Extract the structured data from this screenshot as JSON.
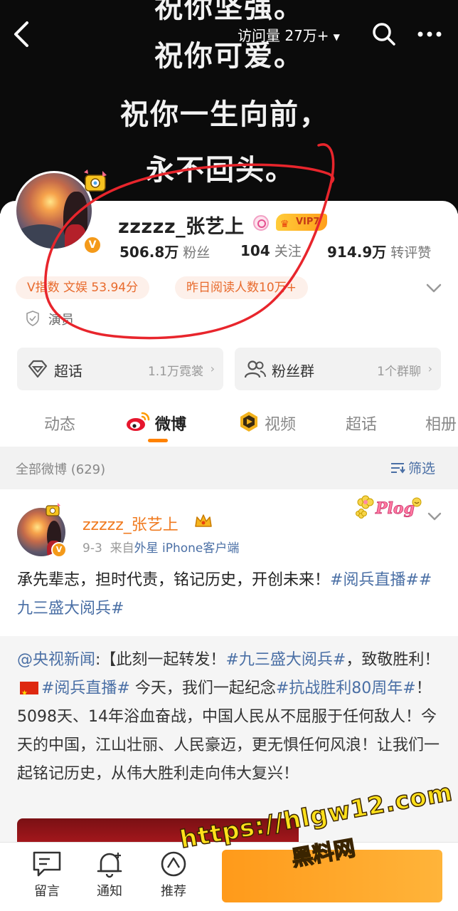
{
  "banner": {
    "lines": [
      "祝你坚强。",
      "祝你可爱。",
      "祝你一生向前，",
      "永不回头。"
    ]
  },
  "topbar": {
    "visits": "访问量 27万+"
  },
  "profile": {
    "name": "zzzzz_张艺上",
    "vip_level": "VIP7",
    "stats": [
      {
        "value": "506.8万",
        "label": "粉丝"
      },
      {
        "value": "104",
        "label": "关注"
      },
      {
        "value": "914.9万",
        "label": "转评赞"
      }
    ],
    "tags": [
      "V指数 文娱 53.94分",
      "昨日阅读人数10万+"
    ],
    "occupation": "演员"
  },
  "cards": [
    {
      "label": "超话",
      "meta": "1.1万霓裳"
    },
    {
      "label": "粉丝群",
      "meta": "1个群聊"
    }
  ],
  "tabs": [
    "动态",
    "微博",
    "视频",
    "超话",
    "相册"
  ],
  "filter": {
    "all_label": "全部微博 (629)",
    "filter_label": "筛选"
  },
  "post": {
    "author": "zzzzz_张艺上",
    "time": "9-3",
    "source_prefix": "来自",
    "source": "外星 iPhone客户端",
    "text": "承先辈志，担时代责，铭记历史，开创未来！",
    "tags": "#阅兵直播##九三盛大阅兵#",
    "plog": "Plog",
    "repost": {
      "author": "@央视新闻",
      "part1": ":【此刻一起转发！",
      "tag1": "#九三盛大阅兵#",
      "part2": "，致敬胜利！",
      "tag2": "#阅兵直播#",
      "part3": " 今天，我们一起纪念",
      "tag3": "#抗战胜利80周年#",
      "part4": "！5098天、14年浴血奋战，中国人民从不屈服于任何敌人！今天的中国，江山壮丽、人民豪迈，更无惧任何风浪！让我们一起铭记历史，从伟大胜利走向伟大复兴！"
    }
  },
  "bottombar": [
    {
      "label": "留言",
      "icon": "message-icon"
    },
    {
      "label": "通知",
      "icon": "bell-icon"
    },
    {
      "label": "推荐",
      "icon": "compass-icon"
    }
  ],
  "watermark": {
    "url": "https://hlgw12.com",
    "name": "黑料网"
  },
  "colors": {
    "brand_orange": "#ff8200",
    "link_blue": "#4a6fa5",
    "annotation_red": "#e8252c"
  }
}
